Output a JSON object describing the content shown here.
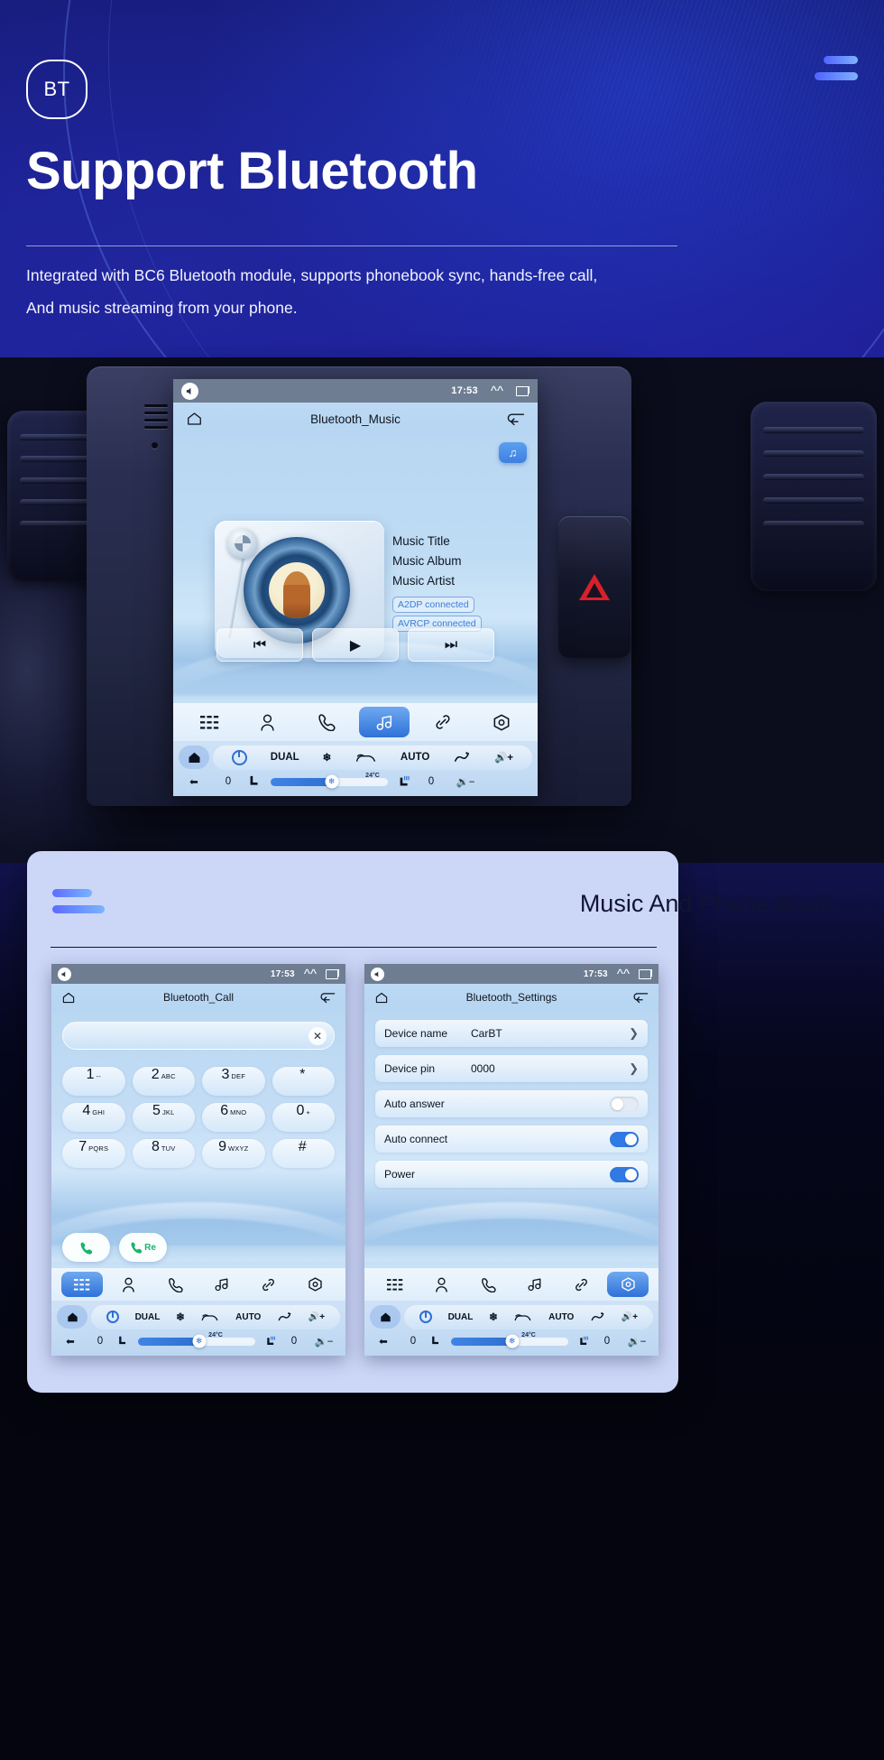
{
  "hero": {
    "badge": "BT",
    "title": "Support Bluetooth",
    "subtitle_line1": "Integrated with BC6 Bluetooth module, supports phonebook sync, hands-free call,",
    "subtitle_line2": "And music streaming from your phone."
  },
  "colors": {
    "hero_bg": "#1b1f91",
    "accent": "#4f63ff",
    "accent_light": "#7fb2ff",
    "card_bg": "#ccd6f7",
    "screen_bg": "#b9d7f2",
    "statusbar_bg": "#6e7d92",
    "tab_active": "#2f72d8",
    "toggle_on": "#2f7ae5",
    "call_green": "#19b36b",
    "hazard_red": "#d8202a"
  },
  "main_screen": {
    "status": {
      "time": "17:53",
      "mute_icon": "volume-mute-icon",
      "expand_icon": "chevron-up-icon",
      "recents_icon": "recent-apps-icon"
    },
    "home_icon": "home-icon",
    "title": "Bluetooth_Music",
    "back_icon": "back-arrow-icon",
    "note_chip_icon": "music-note-icon",
    "track": {
      "title": "Music Title",
      "album": "Music Album",
      "artist": "Music Artist",
      "a2dp": "A2DP  connected",
      "avrcp": "AVRCP connected"
    },
    "transport": {
      "prev": "⏮",
      "play": "▶",
      "next": "⏭"
    },
    "tabs": [
      {
        "name": "apps",
        "icon": "grid-apps-icon",
        "active": false
      },
      {
        "name": "contacts",
        "icon": "person-icon",
        "active": false
      },
      {
        "name": "call",
        "icon": "phone-handset-icon",
        "active": false
      },
      {
        "name": "music",
        "icon": "music-note-icon",
        "active": true
      },
      {
        "name": "link",
        "icon": "link-chain-icon",
        "active": false
      },
      {
        "name": "settings",
        "icon": "gear-nut-icon",
        "active": false
      }
    ],
    "hvac": {
      "home_icon": "home-filled-icon",
      "power_icon": "power-icon",
      "dual": "DUAL",
      "snowflake_icon": "snowflake-icon",
      "recirc_icon": "recirculate-icon",
      "auto": "AUTO",
      "defrost_icon": "defrost-icon",
      "vol_up": "volume-up-icon",
      "temp": "24°C",
      "back_icon": "back-arrow-icon",
      "left_value": "0",
      "right_value": "0",
      "seat_icon": "seat-icon",
      "seat_heat_icon": "seat-heat-icon",
      "fan_icon": "fan-icon",
      "vol_down": "volume-down-icon",
      "fan_percent": 52
    }
  },
  "card": {
    "title": "Music And Phone Book"
  },
  "call_screen": {
    "status": {
      "time": "17:53"
    },
    "title": "Bluetooth_Call",
    "home_icon": "home-icon",
    "back_icon": "back-arrow-icon",
    "input_value": "",
    "clear_icon": "clear-x-icon",
    "keys": [
      {
        "num": "1",
        "sub": "--"
      },
      {
        "num": "2",
        "sub": "ABC"
      },
      {
        "num": "3",
        "sub": "DEF"
      },
      {
        "num": "*",
        "sub": ""
      },
      {
        "num": "4",
        "sub": "GHI"
      },
      {
        "num": "5",
        "sub": "JKL"
      },
      {
        "num": "6",
        "sub": "MNO"
      },
      {
        "num": "0",
        "sub": "+"
      },
      {
        "num": "7",
        "sub": "PQRS"
      },
      {
        "num": "8",
        "sub": "TUV"
      },
      {
        "num": "9",
        "sub": "WXYZ"
      },
      {
        "num": "#",
        "sub": ""
      }
    ],
    "call_button_icon": "phone-call-icon",
    "redial_button_label": "Re",
    "tabs": [
      {
        "name": "apps",
        "icon": "grid-apps-icon",
        "active": true
      },
      {
        "name": "contacts",
        "icon": "person-icon",
        "active": false
      },
      {
        "name": "call",
        "icon": "phone-handset-icon",
        "active": false
      },
      {
        "name": "music",
        "icon": "music-note-icon",
        "active": false
      },
      {
        "name": "link",
        "icon": "link-chain-icon",
        "active": false
      },
      {
        "name": "settings",
        "icon": "gear-nut-icon",
        "active": false
      }
    ]
  },
  "settings_screen": {
    "status": {
      "time": "17:53"
    },
    "title": "Bluetooth_Settings",
    "home_icon": "home-icon",
    "back_icon": "back-arrow-icon",
    "rows": [
      {
        "label": "Device name",
        "value": "CarBT",
        "type": "chevron"
      },
      {
        "label": "Device pin",
        "value": "0000",
        "type": "chevron"
      },
      {
        "label": "Auto answer",
        "value": "",
        "type": "toggle",
        "on": false
      },
      {
        "label": "Auto connect",
        "value": "",
        "type": "toggle",
        "on": true
      },
      {
        "label": "Power",
        "value": "",
        "type": "toggle",
        "on": true
      }
    ],
    "tabs": [
      {
        "name": "apps",
        "icon": "grid-apps-icon",
        "active": false
      },
      {
        "name": "contacts",
        "icon": "person-icon",
        "active": false
      },
      {
        "name": "call",
        "icon": "phone-handset-icon",
        "active": false
      },
      {
        "name": "music",
        "icon": "music-note-icon",
        "active": false
      },
      {
        "name": "link",
        "icon": "link-chain-icon",
        "active": false
      },
      {
        "name": "settings",
        "icon": "gear-nut-icon",
        "active": true
      }
    ]
  },
  "hvac_shared": {
    "dual": "DUAL",
    "auto": "AUTO",
    "temp": "24°C",
    "left_value": "0",
    "right_value": "0"
  }
}
